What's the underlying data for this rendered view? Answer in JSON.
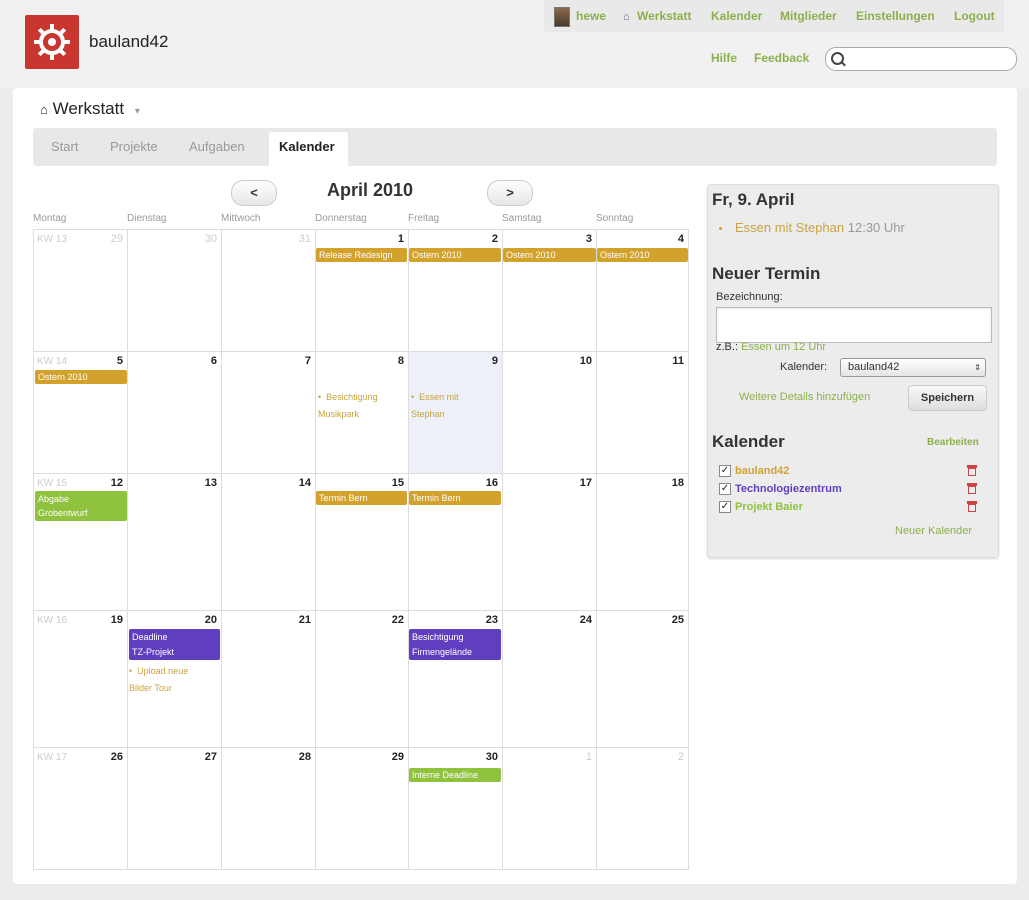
{
  "app": {
    "name": "bauland42"
  },
  "user_nav": {
    "user": "hewe",
    "workshop": "Werkstatt",
    "calendar": "Kalender",
    "members": "Mitglieder",
    "settings": "Einstellungen",
    "logout": "Logout",
    "help": "Hilfe",
    "feedback": "Feedback"
  },
  "search": {
    "placeholder": "",
    "value": ""
  },
  "workspace": {
    "title": "Werkstatt"
  },
  "tabs": [
    {
      "label": "Start"
    },
    {
      "label": "Projekte"
    },
    {
      "label": "Aufgaben"
    },
    {
      "label": "Kalender",
      "active": true
    }
  ],
  "calendar": {
    "month_title": "April 2010",
    "prev_label": "<",
    "next_label": ">",
    "day_names": [
      "Montag",
      "Dienstag",
      "Mittwoch",
      "Donnerstag",
      "Freitag",
      "Samstag",
      "Sonntag"
    ],
    "weeks": [
      {
        "kw": "KW 13",
        "days": [
          "29",
          "30",
          "31",
          "1",
          "2",
          "3",
          "4"
        ],
        "other": [
          true,
          true,
          true,
          false,
          false,
          false,
          false
        ]
      },
      {
        "kw": "KW 14",
        "days": [
          "5",
          "6",
          "7",
          "8",
          "9",
          "10",
          "11"
        ],
        "other": [
          false,
          false,
          false,
          false,
          false,
          false,
          false
        ]
      },
      {
        "kw": "KW 15",
        "days": [
          "12",
          "13",
          "14",
          "15",
          "16",
          "17",
          "18"
        ],
        "other": [
          false,
          false,
          false,
          false,
          false,
          false,
          false
        ]
      },
      {
        "kw": "KW 16",
        "days": [
          "19",
          "20",
          "21",
          "22",
          "23",
          "24",
          "25"
        ],
        "other": [
          false,
          false,
          false,
          false,
          false,
          false,
          false
        ]
      },
      {
        "kw": "KW 17",
        "days": [
          "26",
          "27",
          "28",
          "29",
          "30",
          "1",
          "2"
        ],
        "other": [
          false,
          false,
          false,
          false,
          false,
          true,
          true
        ]
      }
    ],
    "events": {
      "release_redesign": "Release Redesign",
      "ostern_a": "Ostern 2010",
      "ostern_b": "Ostern 2010",
      "ostern_c": "Ostern 2010",
      "ostern_d": "Ostern 2010",
      "ostern_e": "Ostern 2010",
      "besichtigung_1": "Besichtigung",
      "besichtigung_2": "Musikpark",
      "essen_1": "Essen mit",
      "essen_2": "Stephan",
      "abgabe_1": "Abgabe",
      "abgabe_2": "Grobentwurf",
      "termin_a": "Termin Bern",
      "termin_b": "Termin Bern",
      "deadline_1": "Deadline",
      "deadline_2": "TZ-Projekt",
      "upload_1": "Upload neue",
      "upload_2": "Bilder Tour",
      "besich_firm_1": "Besichtigung",
      "besich_firm_2": "Firmengelände",
      "interne_deadline": "Interne Deadline"
    }
  },
  "sidebar": {
    "date_title": "Fr, 9. April",
    "today_event": {
      "name": "Essen mit Stephan",
      "time": "12:30 Uhr"
    },
    "new_event_title": "Neuer Termin",
    "bezeichnung_label": "Bezeichnung:",
    "example_prefix": "z.B.:",
    "example_text": "Essen um 12 Uhr",
    "kalender_label": "Kalender:",
    "kalender_value": "bauland42",
    "more_details": "Weitere Details hinzufügen",
    "save_label": "Speichern",
    "calendars_title": "Kalender",
    "edit_label": "Bearbeiten",
    "calendars": [
      {
        "name": "bauland42",
        "color": "#d2a22d"
      },
      {
        "name": "Technologiezentrum",
        "color": "#5f3fc0"
      },
      {
        "name": "Projekt Baier",
        "color": "#8fc23d"
      }
    ],
    "new_calendar": "Neuer Kalender"
  },
  "colors": {
    "accent_green": "#8cb04c",
    "gold": "#d2a22d",
    "purple": "#5f3fc0",
    "lime": "#8fc23d",
    "logo_red": "#c8362f"
  }
}
